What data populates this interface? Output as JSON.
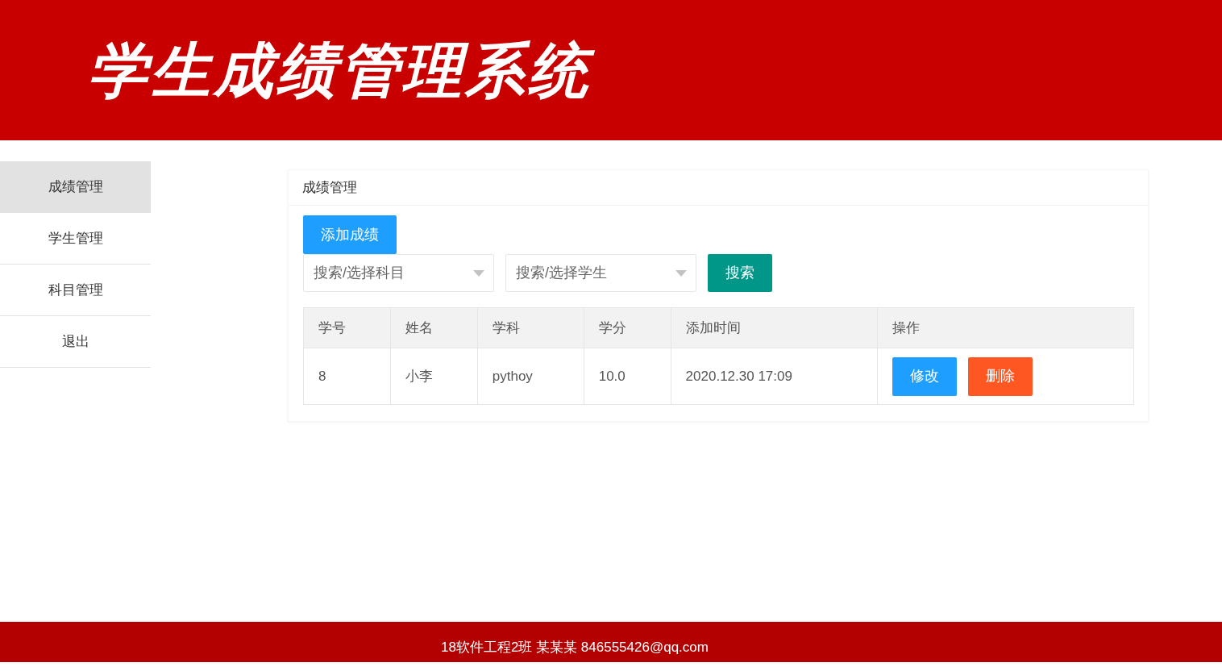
{
  "header": {
    "title": "学生成绩管理系统"
  },
  "sidebar": {
    "items": [
      {
        "label": "成绩管理",
        "selected": true
      },
      {
        "label": "学生管理",
        "selected": false
      },
      {
        "label": "科目管理",
        "selected": false
      },
      {
        "label": "退出",
        "selected": false
      }
    ]
  },
  "panel": {
    "title": "成绩管理",
    "add_button": "添加成绩",
    "filters": [
      {
        "placeholder": "搜索/选择科目"
      },
      {
        "placeholder": "搜索/选择学生"
      }
    ],
    "search_button": "搜索",
    "table": {
      "columns": [
        "学号",
        "姓名",
        "学科",
        "学分",
        "添加时间",
        "操作"
      ],
      "rows": [
        {
          "cells": [
            "8",
            "小李",
            "pythoy",
            "10.0",
            "2020.12.30 17:09"
          ],
          "actions": [
            {
              "label": "修改",
              "kind": "edit"
            },
            {
              "label": "删除",
              "kind": "delete"
            }
          ]
        }
      ]
    }
  },
  "footer": {
    "text": "18软件工程2班 某某某 846555426@qq.com"
  }
}
